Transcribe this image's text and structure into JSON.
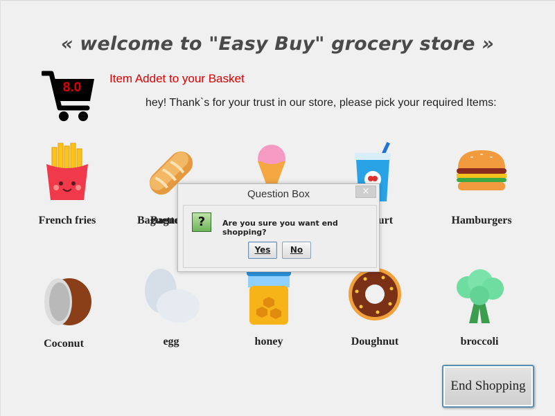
{
  "header": {
    "title": "« welcome to \"Easy Buy\" grocery store »",
    "cart_badge": "8.0",
    "status_message": "Item Addet to your Basket",
    "greeting": "hey! Thank`s for your trust in our store, please pick your required Items:"
  },
  "items": [
    {
      "label": "French fries",
      "icon": "french-fries-icon"
    },
    {
      "label": "Baguette",
      "icon": "baguette-icon"
    },
    {
      "label": "",
      "icon": "ice-cream-icon"
    },
    {
      "label": "Yogurt",
      "icon": "yogurt-icon"
    },
    {
      "label": "Hamburgers",
      "icon": "hamburger-icon"
    },
    {
      "label": "Coconut",
      "icon": "coconut-icon"
    },
    {
      "label": "egg",
      "icon": "egg-icon"
    },
    {
      "label": "honey",
      "icon": "honey-icon"
    },
    {
      "label": "Doughnut",
      "icon": "doughnut-icon"
    },
    {
      "label": "broccoli",
      "icon": "broccoli-icon"
    }
  ],
  "end_button": {
    "label": "End Shopping"
  },
  "dialog": {
    "title": "Question Box",
    "close_label": "×",
    "question_mark": "?",
    "message": "Are you sure you want end shopping?",
    "yes_label": "Yes",
    "no_label": "No"
  },
  "colors": {
    "status": "#e00000",
    "title": "#4a4a4a",
    "button_border": "#5a8fb0"
  }
}
